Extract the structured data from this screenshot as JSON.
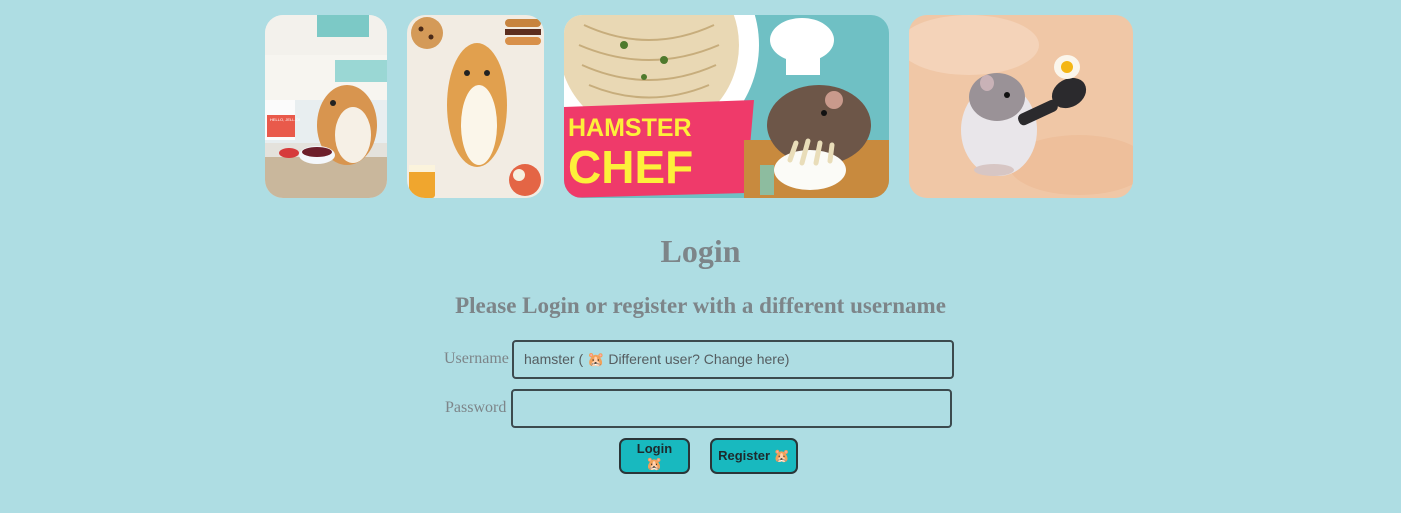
{
  "gallery": {
    "photo_1_caption": "HELLO, JELL-O!",
    "photo_3_text_line1": "HAMSTER",
    "photo_3_text_line2": "CHEF"
  },
  "heading": "Login",
  "subheading": "Please Login or register with a different username",
  "form": {
    "username_label": "Username",
    "username_value": "hamster ( 🐹 Different user? Change here)",
    "password_label": "Password",
    "password_value": ""
  },
  "buttons": {
    "login_label": "Login 🐹",
    "register_label": "Register 🐹"
  },
  "colors": {
    "background": "#aedde3",
    "text": "#7d8589",
    "button": "#18b9bf"
  }
}
